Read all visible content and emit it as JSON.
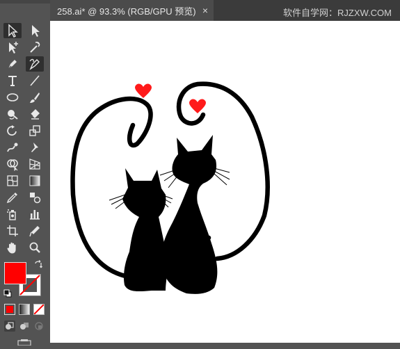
{
  "document_tab": {
    "title": "258.ai* @ 93.3% (RGB/GPU 预览)",
    "close_glyph": "×"
  },
  "watermark": "软件自学网：RJZXW.COM",
  "colors": {
    "ui_panel": "#535353",
    "tab_bar": "#3b3b3b",
    "active_tab": "#4b4b4b",
    "fill": "#ff0000",
    "heart": "#ff1a1a",
    "artwork": "#000000",
    "canvas": "#ffffff"
  },
  "tools": [
    "selection-tool-icon",
    "direct-selection-tool-icon",
    "group-selection-tool-icon",
    "magic-wand-icon",
    "pen-tool-icon",
    "curvature-tool-icon",
    "type-tool-icon",
    "line-segment-tool-icon",
    "ellipse-tool-icon",
    "paintbrush-tool-icon",
    "shaper-tool-icon",
    "eraser-tool-icon",
    "rotate-tool-icon",
    "scale-tool-icon",
    "warp-tool-icon",
    "puppet-warp-tool-icon",
    "shape-builder-tool-icon",
    "perspective-grid-tool-icon",
    "mesh-tool-icon",
    "gradient-tool-icon",
    "eyedropper-tool-icon",
    "blend-tool-icon",
    "symbol-sprayer-tool-icon",
    "column-graph-tool-icon",
    "artboard-tool-icon",
    "slice-tool-icon",
    "hand-tool-icon",
    "zoom-tool-icon"
  ]
}
